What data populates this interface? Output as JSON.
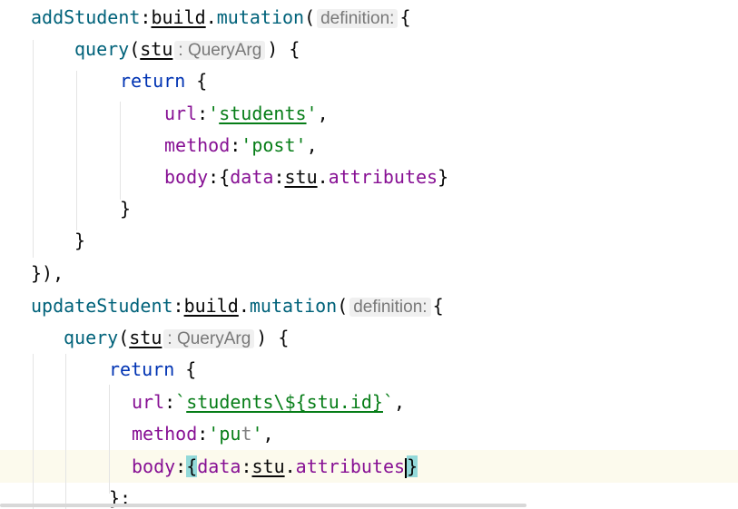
{
  "hints": {
    "definition": "definition:",
    "query_arg": ": QueryArg"
  },
  "block1": {
    "name": "addStudent",
    "build": "build",
    "mutation": "mutation",
    "query": "query",
    "param": "stu",
    "return_kw": "return",
    "url_key": "url",
    "url_value": "students",
    "method_key": "method",
    "method_value": "post",
    "body_key": "body",
    "data_key": "data",
    "param_ref": "stu",
    "attributes": "attributes",
    "closing": "}),"
  },
  "block2": {
    "name": "updateStudent",
    "build": "build",
    "mutation": "mutation",
    "query": "query",
    "param": "stu",
    "return_kw": "return",
    "url_key": "url",
    "url_value": "students\\${stu.id}",
    "method_key": "method",
    "method_value_a": "pu",
    "method_value_b": "t",
    "body_key": "body",
    "data_key": "data",
    "param_ref": "stu",
    "attributes": "attributes",
    "closing": "};"
  },
  "colors": {
    "function_name": "#00627a",
    "property": "#871094",
    "keyword": "#0033b3",
    "string": "#067d17",
    "hint_text": "#787878",
    "current_line": "#fcfaed",
    "brace_match": "#93d9d9"
  }
}
